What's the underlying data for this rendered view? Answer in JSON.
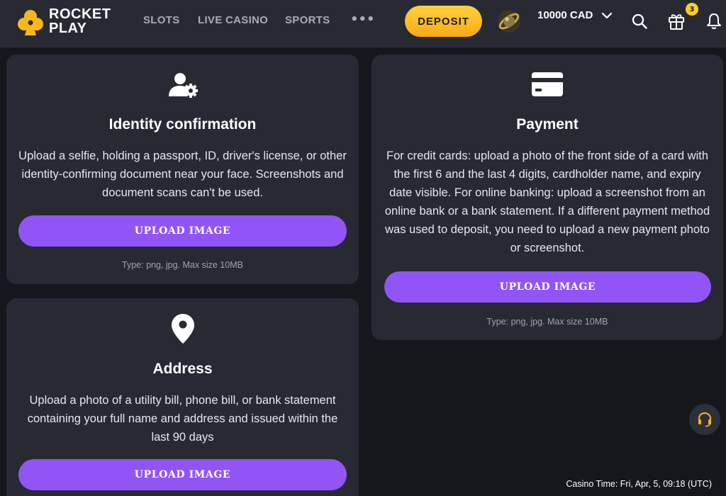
{
  "brand": {
    "line1": "ROCKET",
    "line2": "PLAY"
  },
  "nav": {
    "items": [
      "SLOTS",
      "LIVE CASINO",
      "SPORTS"
    ],
    "more": "•••"
  },
  "header": {
    "deposit_label": "DEPOSIT",
    "balance": "10000 CAD",
    "notification_count": "3"
  },
  "cards": {
    "identity": {
      "icon": "user-gear-icon",
      "title": "Identity confirmation",
      "description": "Upload a selfie, holding a passport, ID, driver's license, or other identity-confirming document near your face. Screenshots and document scans can't be used.",
      "button": "UPLOAD IMAGE",
      "hint": "Type: png, jpg. Max size 10MB"
    },
    "payment": {
      "icon": "credit-card-icon",
      "title": "Payment",
      "description": "For credit cards: upload a photo of the front side of a card with the first 6 and the last 4 digits, cardholder name, and expiry date visible. For online banking: upload a screenshot from an online bank or a bank statement. If a different payment method was used to deposit, you need to upload a new payment photo or screenshot.",
      "button": "UPLOAD IMAGE",
      "hint": "Type: png, jpg. Max size 10MB"
    },
    "address": {
      "icon": "location-pin-icon",
      "title": "Address",
      "description": "Upload a photo of a utility bill, phone bill, or bank statement containing your full name and address and issued within the last 90 days",
      "button": "UPLOAD IMAGE"
    }
  },
  "footer": {
    "casino_time": "Casino Time: Fri, Apr, 5, 09:18 (UTC)"
  },
  "colors": {
    "accent": "#9155f5",
    "deposit": "#ffc11f",
    "card_bg": "#272a33",
    "page_bg": "#14171c"
  }
}
